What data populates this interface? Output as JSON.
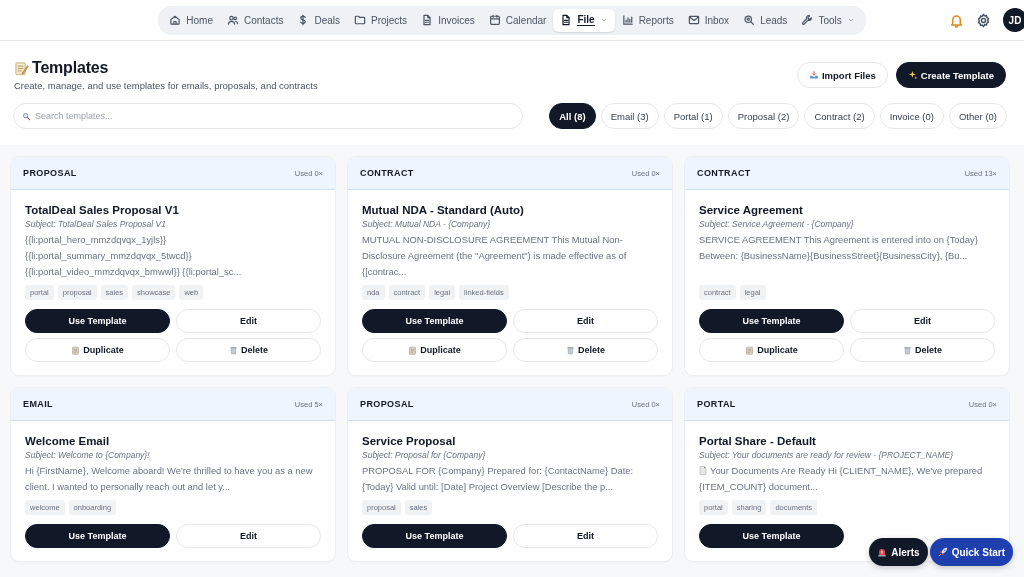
{
  "nav": {
    "items": [
      {
        "label": "Home",
        "selected": false,
        "dropdown": false
      },
      {
        "label": "Contacts",
        "selected": false,
        "dropdown": false
      },
      {
        "label": "Deals",
        "selected": false,
        "dropdown": false
      },
      {
        "label": "Projects",
        "selected": false,
        "dropdown": false
      },
      {
        "label": "Invoices",
        "selected": false,
        "dropdown": false
      },
      {
        "label": "Calendar",
        "selected": false,
        "dropdown": false
      },
      {
        "label": "File",
        "selected": true,
        "dropdown": true
      },
      {
        "label": "Reports",
        "selected": false,
        "dropdown": false
      },
      {
        "label": "Inbox",
        "selected": false,
        "dropdown": false
      },
      {
        "label": "Leads",
        "selected": false,
        "dropdown": false
      },
      {
        "label": "Tools",
        "selected": false,
        "dropdown": true
      }
    ],
    "avatar": "JD"
  },
  "header": {
    "title": "Templates",
    "subtitle": "Create, manage, and use templates for emails, proposals, and contracts",
    "buttons": [
      {
        "label": "Import Files",
        "kind": "secondary"
      },
      {
        "label": "Create Template",
        "kind": "primary"
      }
    ]
  },
  "search": {
    "placeholder": "Search templates..."
  },
  "filters": [
    {
      "label": "All (8)",
      "selected": true
    },
    {
      "label": "Email (3)",
      "selected": false
    },
    {
      "label": "Portal (1)",
      "selected": false
    },
    {
      "label": "Proposal (2)",
      "selected": false
    },
    {
      "label": "Contract (2)",
      "selected": false
    },
    {
      "label": "Invoice (0)",
      "selected": false
    },
    {
      "label": "Other (0)",
      "selected": false
    }
  ],
  "templates": [
    {
      "category": "PROPOSAL",
      "used": "Used 0×",
      "title": "TotalDeal Sales Proposal V1",
      "subject": "Subject: TotalDeal Sales Proposal V1",
      "preview": "{{li:portal_hero_mmzdqvqx_1yjls}} {{li:portal_summary_mmzdqvqx_5twcd}} {{li:portal_video_mmzdqvqx_bmwwl}} {{li:portal_sc...",
      "tags": [
        "portal",
        "proposal",
        "sales",
        "showcase",
        "web"
      ],
      "actions": [
        {
          "label": "Use Template",
          "kind": "primary"
        },
        {
          "label": "Edit",
          "kind": "secondary"
        },
        {
          "label": "Duplicate",
          "kind": "duplicate"
        },
        {
          "label": "Delete",
          "kind": "delete"
        }
      ]
    },
    {
      "category": "CONTRACT",
      "used": "Used 0×",
      "title": "Mutual NDA - Standard (Auto)",
      "subject": "Subject: Mutual NDA - {Company}",
      "preview": "MUTUAL NON-DISCLOSURE AGREEMENT This Mutual Non-Disclosure Agreement (the \"Agreement\") is made effective as of {[contrac...",
      "tags": [
        "nda",
        "contract",
        "legal",
        "linked-fields"
      ],
      "actions": [
        {
          "label": "Use Template",
          "kind": "primary"
        },
        {
          "label": "Edit",
          "kind": "secondary"
        },
        {
          "label": "Duplicate",
          "kind": "duplicate"
        },
        {
          "label": "Delete",
          "kind": "delete"
        }
      ]
    },
    {
      "category": "CONTRACT",
      "used": "Used 13×",
      "title": "Service Agreement",
      "subject": "Subject: Service Agreement - {Company}",
      "preview": "SERVICE AGREEMENT This Agreement is entered into on {Today} Between: {BusinessName}{BusinessStreet}{BusinessCity}, {Bu...",
      "tags": [
        "contract",
        "legal"
      ],
      "actions": [
        {
          "label": "Use Template",
          "kind": "primary"
        },
        {
          "label": "Edit",
          "kind": "secondary"
        },
        {
          "label": "Duplicate",
          "kind": "duplicate"
        },
        {
          "label": "Delete",
          "kind": "delete"
        }
      ]
    },
    {
      "category": "EMAIL",
      "used": "Used 5×",
      "title": "Welcome Email",
      "subject": "Subject: Welcome to {Company}!",
      "preview": "Hi {FirstName}, Welcome aboard! We're thrilled to have you as a new client. I wanted to personally reach out and let y...",
      "tags": [
        "welcome",
        "onboarding"
      ],
      "actions": [
        {
          "label": "Use Template",
          "kind": "primary"
        },
        {
          "label": "Edit",
          "kind": "secondary"
        }
      ]
    },
    {
      "category": "PROPOSAL",
      "used": "Used 0×",
      "title": "Service Proposal",
      "subject": "Subject: Proposal for {Company}",
      "preview": "PROPOSAL FOR {Company} Prepared for: {ContactName} Date: {Today} Valid until: [Date] Project Overview [Describe the p...",
      "tags": [
        "proposal",
        "sales"
      ],
      "actions": [
        {
          "label": "Use Template",
          "kind": "primary"
        },
        {
          "label": "Edit",
          "kind": "secondary"
        }
      ]
    },
    {
      "category": "PORTAL",
      "used": "Used 0×",
      "title": "Portal Share - Default",
      "subject": "Subject: Your documents are ready for review - {PROJECT_NAME}",
      "preview": "Your Documents Are Ready Hi {CLIENT_NAME}, We've prepared {ITEM_COUNT} document...",
      "preview_icon": true,
      "tags": [
        "portal",
        "sharing",
        "documents"
      ],
      "actions": [
        {
          "label": "Use Template",
          "kind": "primary"
        }
      ]
    }
  ],
  "floating": [
    {
      "label": "Alerts",
      "kind": "alerts"
    },
    {
      "label": "Quick Start",
      "kind": "quickstart"
    }
  ]
}
